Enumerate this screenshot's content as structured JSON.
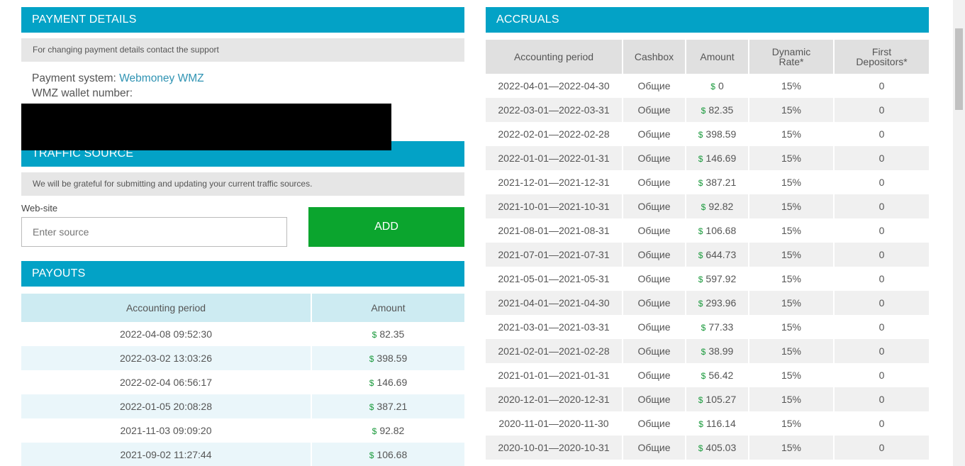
{
  "payment_details": {
    "title": "PAYMENT DETAILS",
    "notice": "For changing payment details contact the support",
    "system_label": "Payment system:",
    "system_value": "Webmoney WMZ",
    "wallet_label": "WMZ wallet number:"
  },
  "traffic_source": {
    "title": "TRAFFIC SOURCE",
    "notice": "We will be grateful for submitting and updating your current traffic sources.",
    "website_label": "Web-site",
    "input_placeholder": "Enter source",
    "add_label": "ADD"
  },
  "payouts": {
    "title": "PAYOUTS",
    "columns": [
      "Accounting period",
      "Amount"
    ],
    "currency": "$",
    "rows": [
      {
        "period": "2022-04-08 09:52:30",
        "amount": "82.35"
      },
      {
        "period": "2022-03-02 13:03:26",
        "amount": "398.59"
      },
      {
        "period": "2022-02-04 06:56:17",
        "amount": "146.69"
      },
      {
        "period": "2022-01-05 20:08:28",
        "amount": "387.21"
      },
      {
        "period": "2021-11-03 09:09:20",
        "amount": "92.82"
      },
      {
        "period": "2021-09-02 11:27:44",
        "amount": "106.68"
      }
    ]
  },
  "accruals": {
    "title": "ACCRUALS",
    "columns": [
      "Accounting period",
      "Cashbox",
      "Amount",
      "Dynamic Rate*",
      "First Depositors*"
    ],
    "currency": "$",
    "rows": [
      {
        "period": "2022-04-01—2022-04-30",
        "cashbox": "Общие",
        "amount": "0",
        "rate": "15%",
        "depositors": "0"
      },
      {
        "period": "2022-03-01—2022-03-31",
        "cashbox": "Общие",
        "amount": "82.35",
        "rate": "15%",
        "depositors": "0"
      },
      {
        "period": "2022-02-01—2022-02-28",
        "cashbox": "Общие",
        "amount": "398.59",
        "rate": "15%",
        "depositors": "0"
      },
      {
        "period": "2022-01-01—2022-01-31",
        "cashbox": "Общие",
        "amount": "146.69",
        "rate": "15%",
        "depositors": "0"
      },
      {
        "period": "2021-12-01—2021-12-31",
        "cashbox": "Общие",
        "amount": "387.21",
        "rate": "15%",
        "depositors": "0"
      },
      {
        "period": "2021-10-01—2021-10-31",
        "cashbox": "Общие",
        "amount": "92.82",
        "rate": "15%",
        "depositors": "0"
      },
      {
        "period": "2021-08-01—2021-08-31",
        "cashbox": "Общие",
        "amount": "106.68",
        "rate": "15%",
        "depositors": "0"
      },
      {
        "period": "2021-07-01—2021-07-31",
        "cashbox": "Общие",
        "amount": "644.73",
        "rate": "15%",
        "depositors": "0"
      },
      {
        "period": "2021-05-01—2021-05-31",
        "cashbox": "Общие",
        "amount": "597.92",
        "rate": "15%",
        "depositors": "0"
      },
      {
        "period": "2021-04-01—2021-04-30",
        "cashbox": "Общие",
        "amount": "293.96",
        "rate": "15%",
        "depositors": "0"
      },
      {
        "period": "2021-03-01—2021-03-31",
        "cashbox": "Общие",
        "amount": "77.33",
        "rate": "15%",
        "depositors": "0"
      },
      {
        "period": "2021-02-01—2021-02-28",
        "cashbox": "Общие",
        "amount": "38.99",
        "rate": "15%",
        "depositors": "0"
      },
      {
        "period": "2021-01-01—2021-01-31",
        "cashbox": "Общие",
        "amount": "56.42",
        "rate": "15%",
        "depositors": "0"
      },
      {
        "period": "2020-12-01—2020-12-31",
        "cashbox": "Общие",
        "amount": "105.27",
        "rate": "15%",
        "depositors": "0"
      },
      {
        "period": "2020-11-01—2020-11-30",
        "cashbox": "Общие",
        "amount": "116.14",
        "rate": "15%",
        "depositors": "0"
      },
      {
        "period": "2020-10-01—2020-10-31",
        "cashbox": "Общие",
        "amount": "405.03",
        "rate": "15%",
        "depositors": "0"
      }
    ]
  },
  "colors": {
    "header": "#03a2c6",
    "add_button": "#0ba52e",
    "dollar": "#1a9a3c",
    "link": "#2f93b3"
  }
}
